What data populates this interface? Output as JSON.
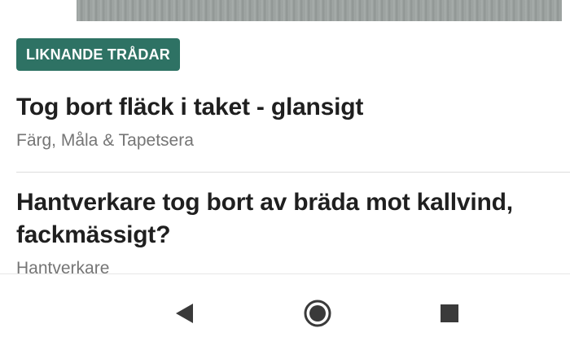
{
  "section": {
    "badge": "LIKNANDE TRÅDAR",
    "badge_color": "#2e7264"
  },
  "threads": [
    {
      "title": "Tog bort fläck i taket - glansigt",
      "category": "Färg, Måla & Tapetsera"
    },
    {
      "title": "Hantverkare tog bort av bräda mot kallvind, fackmässigt?",
      "category": "Hantverkare"
    }
  ],
  "navigation": {
    "back_icon": "back-triangle-icon",
    "home_icon": "home-circle-icon",
    "recent_icon": "recent-apps-square-icon"
  }
}
